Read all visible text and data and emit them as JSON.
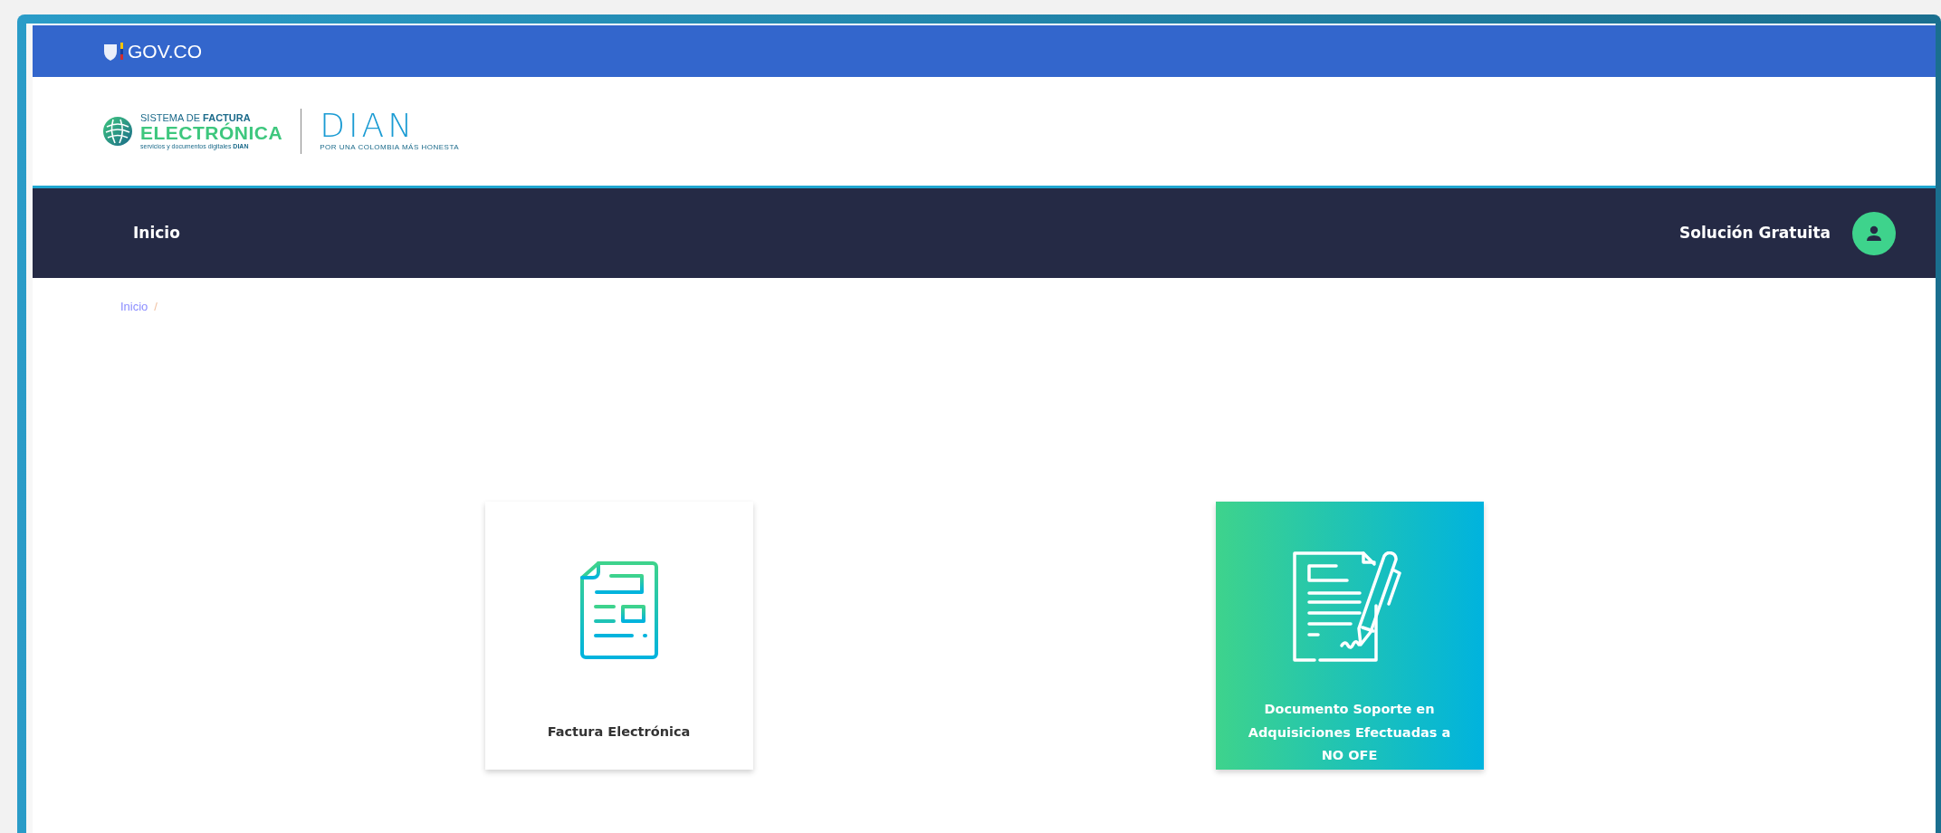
{
  "gov_bar": {
    "label": "GOV.CO"
  },
  "header": {
    "logo_line_1": "SISTEMA DE **FACTURA**",
    "logo_line_2": "ELECTRÓNICA",
    "logo_line_3": "servicios y documentos digitales **DIAN**",
    "brand": "DIAN",
    "brand_tagline": "POR UNA COLOMBIA MÁS HONESTA"
  },
  "navbar": {
    "items": [
      {
        "label": "Inicio"
      }
    ],
    "right_label": "Solución Gratuita"
  },
  "breadcrumb": [
    {
      "label": "Inicio",
      "separator": "/"
    }
  ],
  "cards": [
    {
      "kind": "invoice",
      "title": "Factura Electrónica",
      "selected": false
    },
    {
      "kind": "signed-document",
      "title": "Documento Soporte en Adquisiciones Efectuadas a NO OFE",
      "selected": true
    }
  ]
}
